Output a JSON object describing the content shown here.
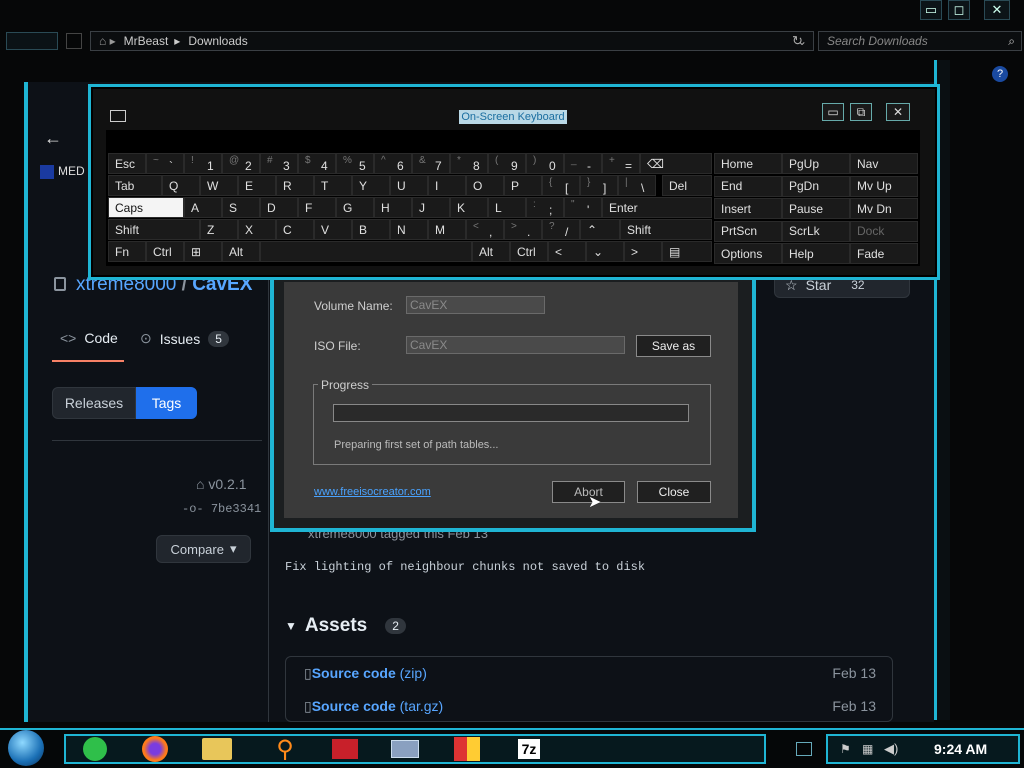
{
  "explorer": {
    "path": [
      "MrBeast",
      "Downloads"
    ],
    "search_placeholder": "Search Downloads"
  },
  "github": {
    "bookmark": "MED",
    "repo_owner": "xtreme8000",
    "repo_sep": "/",
    "repo_name": "CavEX",
    "star_label": "Star",
    "star_count": "32",
    "tabs": [
      {
        "label": "Code"
      },
      {
        "label": "Issues",
        "count": "5"
      }
    ],
    "releases_label": "Releases",
    "tags_label": "Tags",
    "tag": "v0.2.1",
    "commit": "7be3341",
    "compare_label": "Compare",
    "tagged_text": "xtreme8000 tagged this Feb 13",
    "commit_message": "Fix lighting of neighbour chunks not saved to disk",
    "assets_label": "Assets",
    "assets_count": "2",
    "assets": [
      {
        "name": "Source code",
        "ext": "(zip)",
        "date": "Feb 13"
      },
      {
        "name": "Source code",
        "ext": "(tar.gz)",
        "date": "Feb 13"
      }
    ]
  },
  "keyboard": {
    "title": "On-Screen Keyboard",
    "row1": [
      {
        "sh": "~",
        "k": "`"
      },
      {
        "sh": "!",
        "k": "1"
      },
      {
        "sh": "@",
        "k": "2"
      },
      {
        "sh": "#",
        "k": "3"
      },
      {
        "sh": "$",
        "k": "4"
      },
      {
        "sh": "%",
        "k": "5"
      },
      {
        "sh": "^",
        "k": "6"
      },
      {
        "sh": "&",
        "k": "7"
      },
      {
        "sh": "*",
        "k": "8"
      },
      {
        "sh": "(",
        "k": "9"
      },
      {
        "sh": ")",
        "k": "0"
      },
      {
        "sh": "_",
        "k": "-"
      },
      {
        "sh": "+",
        "k": "="
      }
    ],
    "row2": [
      "Q",
      "W",
      "E",
      "R",
      "T",
      "Y",
      "U",
      "I",
      "O",
      "P"
    ],
    "row2_brackets": [
      {
        "sh": "{",
        "k": "["
      },
      {
        "sh": "}",
        "k": "]"
      },
      {
        "sh": "|",
        "k": "\\"
      }
    ],
    "row3": [
      "A",
      "S",
      "D",
      "F",
      "G",
      "H",
      "J",
      "K",
      "L"
    ],
    "row3_punct": [
      {
        "sh": ":",
        "k": ";"
      },
      {
        "sh": "\"",
        "k": "'"
      }
    ],
    "row4": [
      "Z",
      "X",
      "C",
      "V",
      "B",
      "N",
      "M"
    ],
    "row4_punct": [
      {
        "sh": "<",
        "k": ","
      },
      {
        "sh": ">",
        "k": "."
      },
      {
        "sh": "?",
        "k": "/"
      }
    ],
    "esc": "Esc",
    "tab": "Tab",
    "caps": "Caps",
    "shift": "Shift",
    "fn": "Fn",
    "ctrl": "Ctrl",
    "alt": "Alt",
    "del": "Del",
    "enter": "Enter",
    "nav_left": [
      "Home",
      "End",
      "Insert",
      "PrtScn",
      "Options"
    ],
    "nav_mid": [
      "PgUp",
      "PgDn",
      "Pause",
      "ScrLk",
      "Help"
    ],
    "nav_right": [
      "Nav",
      "Mv Up",
      "Mv Dn",
      "Dock",
      "Fade"
    ]
  },
  "iso": {
    "volume_label": "Volume Name:",
    "volume_value": "CavEX",
    "iso_label": "ISO File:",
    "iso_value": "CavEX",
    "save_as": "Save as",
    "progress_label": "Progress",
    "progress_value": 0,
    "status": "Preparing first set of path tables...",
    "link": "www.freeisocreator.com",
    "abort": "Abort",
    "close": "Close"
  },
  "taskbar": {
    "time": "9:24 AM",
    "sevenzip": "7z"
  },
  "colors": {
    "accent": "#1fb5d4",
    "gh_link": "#58a6ff",
    "gh_bg": "#0d1117"
  }
}
